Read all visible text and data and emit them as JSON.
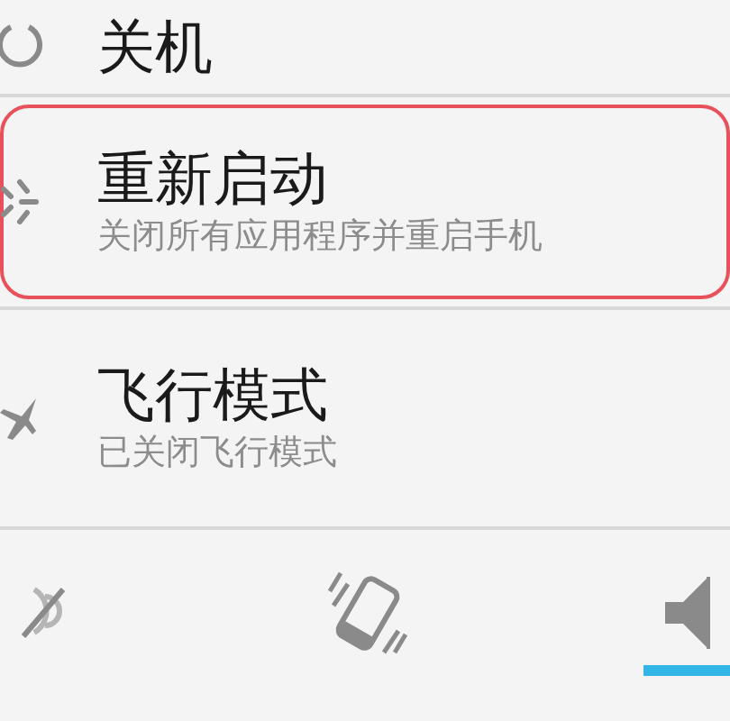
{
  "power_menu": [
    {
      "kind": "power",
      "title": "关机",
      "selected": false
    },
    {
      "kind": "restart",
      "title": "重新启动",
      "subtitle": "关闭所有应用程序并重启手机",
      "selected": true
    },
    {
      "kind": "airplane",
      "title": "飞行模式",
      "subtitle": "已关闭飞行模式",
      "selected": false
    }
  ],
  "sound_modes": [
    {
      "kind": "silent",
      "selected": false
    },
    {
      "kind": "vibrate",
      "selected": false
    },
    {
      "kind": "sound",
      "selected": true
    }
  ]
}
